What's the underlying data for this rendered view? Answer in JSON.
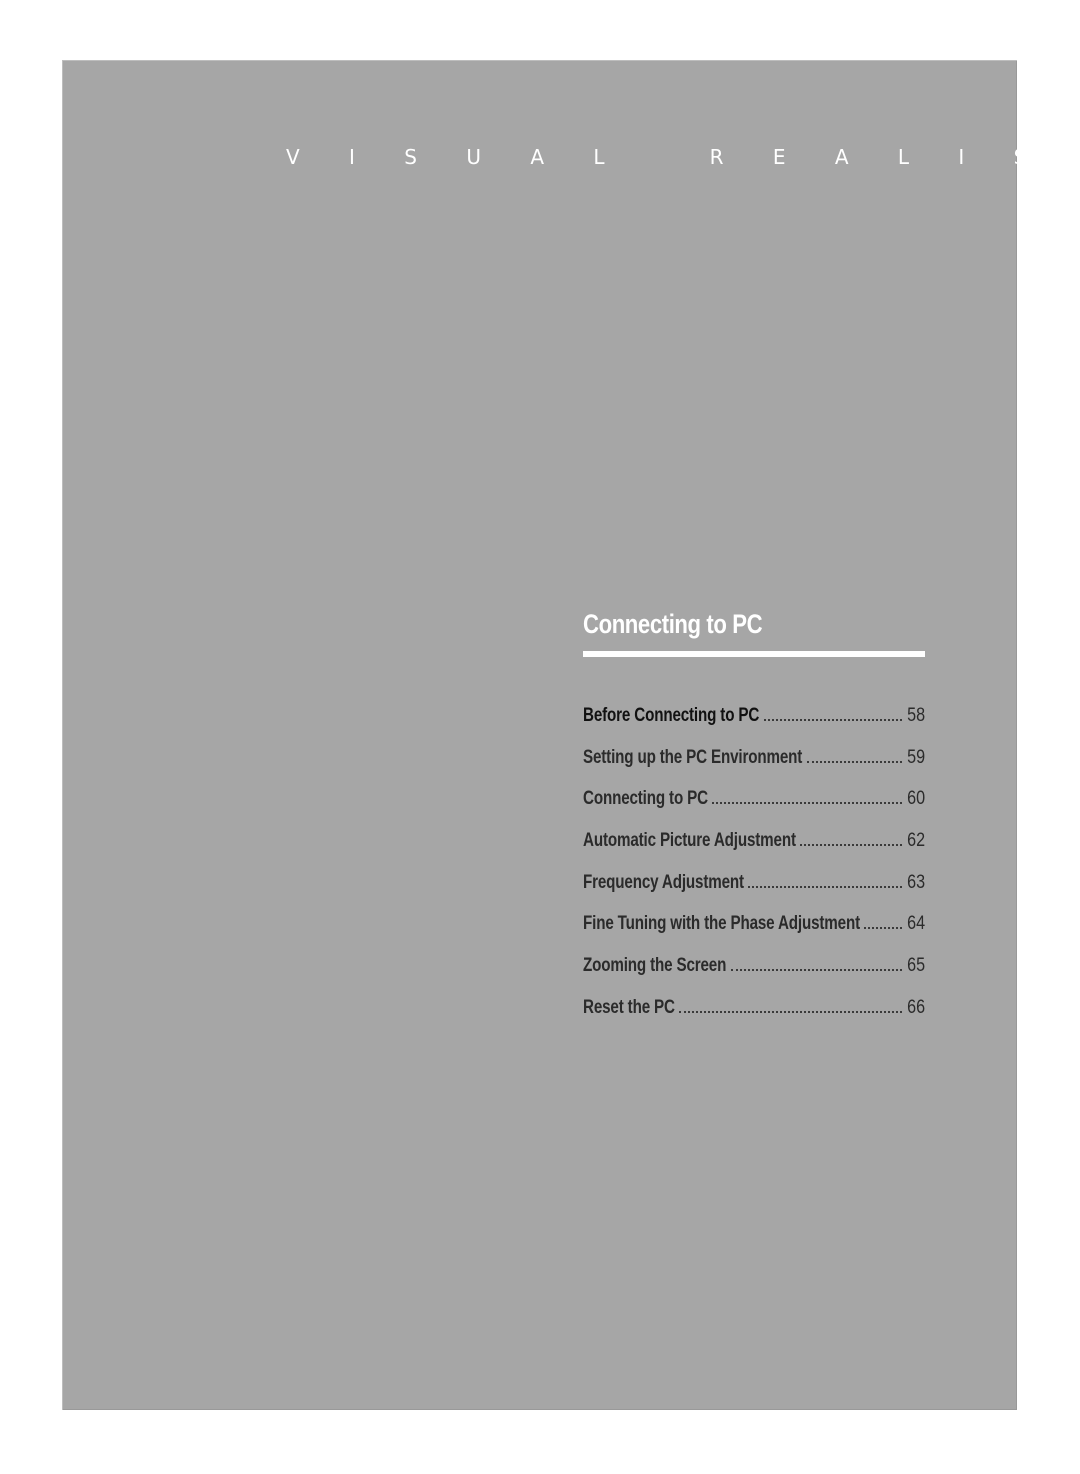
{
  "header": {
    "brand_text": "V I S U A L   R E A L I S M"
  },
  "section": {
    "title": "Connecting to PC"
  },
  "toc": {
    "items": [
      {
        "label": "Before Connecting to PC",
        "page": "58"
      },
      {
        "label": "Setting up the PC Environment",
        "page": "59"
      },
      {
        "label": "Connecting to PC",
        "page": "60"
      },
      {
        "label": "Automatic Picture Adjustment",
        "page": "62"
      },
      {
        "label": "Frequency Adjustment",
        "page": "63"
      },
      {
        "label": "Fine Tuning with the Phase Adjustment",
        "page": "64"
      },
      {
        "label": "Zooming the Screen",
        "page": "65"
      },
      {
        "label": "Reset the PC",
        "page": "66"
      }
    ]
  },
  "colors": {
    "panel_background": "#a6a6a6",
    "title_text": "#ffffff",
    "toc_text": "#2b2b2b",
    "toc_first_text": "#111111"
  }
}
